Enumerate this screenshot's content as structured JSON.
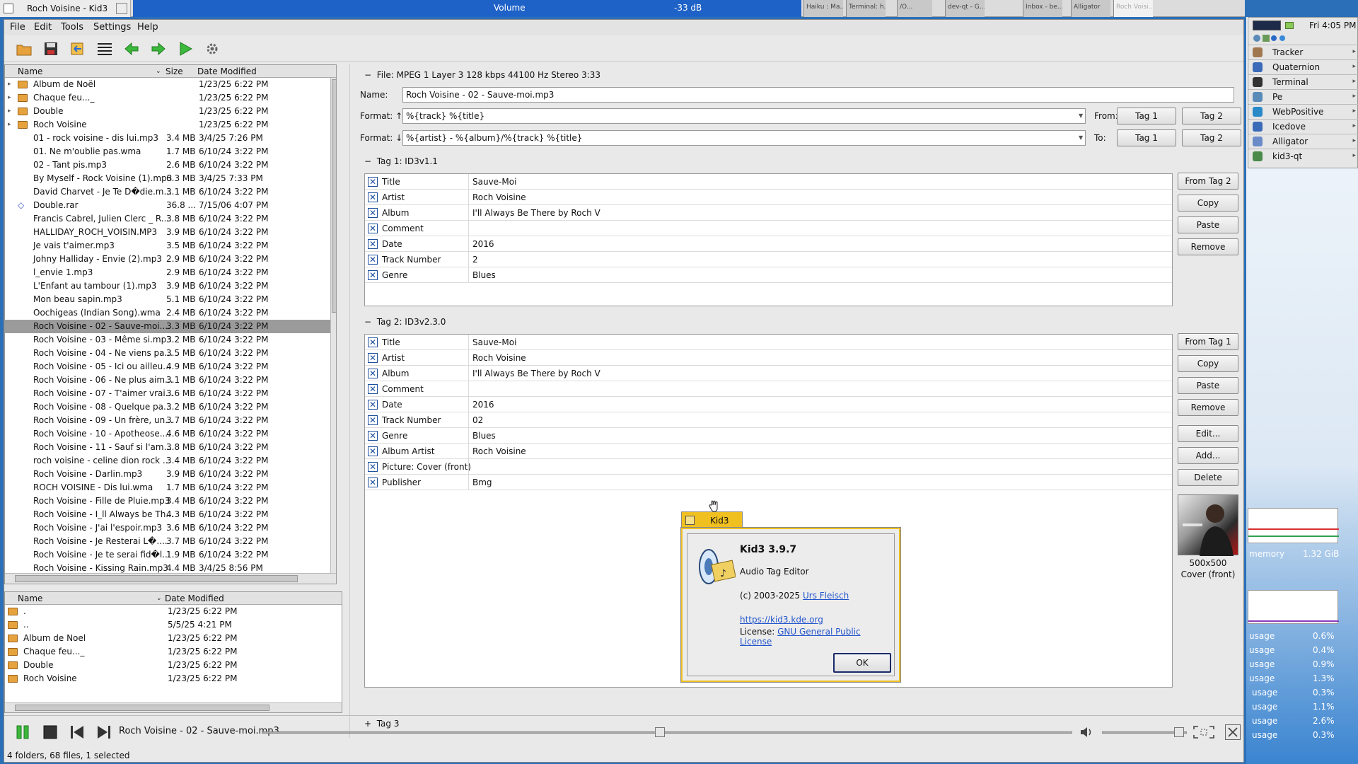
{
  "topbar": {
    "window_title": "Roch Voisine - Kid3",
    "volume_label": "Volume",
    "volume_db": "-33 dB",
    "mini_windows": [
      "Haiku : Ma...",
      "Terminal: h...",
      "/O...",
      "dev-qt - G...",
      "Inbox - be...",
      "Alligator",
      "Roch Voisi..."
    ]
  },
  "menubar": [
    "File",
    "Edit",
    "Tools",
    "Settings",
    "Help"
  ],
  "toolbar_icons": [
    "open-folder-icon",
    "save-icon",
    "revert-icon",
    "select-all-icon",
    "previous-file-icon",
    "next-file-icon",
    "play-icon",
    "settings-icon"
  ],
  "file_list": {
    "headers": {
      "name": "Name",
      "size": "Size",
      "modified": "Date Modified"
    },
    "rows": [
      {
        "name": "Album de Noël",
        "size": "",
        "date": "1/23/25 6:22 PM",
        "folder": true
      },
      {
        "name": "Chaque feu..._",
        "size": "",
        "date": "1/23/25 6:22 PM",
        "folder": true
      },
      {
        "name": "Double",
        "size": "",
        "date": "1/23/25 6:22 PM",
        "folder": true
      },
      {
        "name": "Roch Voisine",
        "size": "",
        "date": "1/23/25 6:22 PM",
        "folder": true
      },
      {
        "name": "01 - rock voisine - dis lui.mp3",
        "size": "3.4 MB",
        "date": "3/4/25 7:26 PM"
      },
      {
        "name": "01. Ne m'oublie pas.wma",
        "size": "1.7 MB",
        "date": "6/10/24 3:22 PM"
      },
      {
        "name": "02 - Tant pis.mp3",
        "size": "2.6 MB",
        "date": "6/10/24 3:22 PM"
      },
      {
        "name": "By Myself - Rock Voisine (1).mp3",
        "size": "6.3 MB",
        "date": "3/4/25 7:33 PM"
      },
      {
        "name": "David Charvet - Je Te D�die.m...",
        "size": "3.1 MB",
        "date": "6/10/24 3:22 PM"
      },
      {
        "name": "Double.rar",
        "size": "36.8 ...",
        "date": "7/15/06 4:07 PM"
      },
      {
        "name": "Francis Cabrel, Julien Clerc _ R...",
        "size": "3.8 MB",
        "date": "6/10/24 3:22 PM"
      },
      {
        "name": "HALLIDAY_ROCH_VOISIN.MP3",
        "size": "3.9 MB",
        "date": "6/10/24 3:22 PM"
      },
      {
        "name": "Je vais t'aimer.mp3",
        "size": "3.5 MB",
        "date": "6/10/24 3:22 PM"
      },
      {
        "name": "Johny Halliday - Envie (2).mp3",
        "size": "2.9 MB",
        "date": "6/10/24 3:22 PM"
      },
      {
        "name": "l_envie 1.mp3",
        "size": "2.9 MB",
        "date": "6/10/24 3:22 PM"
      },
      {
        "name": "L'Enfant au tambour (1).mp3",
        "size": "3.9 MB",
        "date": "6/10/24 3:22 PM"
      },
      {
        "name": "Mon beau sapin.mp3",
        "size": "5.1 MB",
        "date": "6/10/24 3:22 PM"
      },
      {
        "name": "Oochigeas (Indian Song).wma",
        "size": "2.4 MB",
        "date": "6/10/24 3:22 PM"
      },
      {
        "name": "Roch Voisine - 02 - Sauve-moi....",
        "size": "3.3 MB",
        "date": "6/10/24 3:22 PM",
        "selected": true
      },
      {
        "name": "Roch Voisine - 03 - Même si.mp3",
        "size": "3.2 MB",
        "date": "6/10/24 3:22 PM"
      },
      {
        "name": "Roch Voisine - 04 - Ne viens pa...",
        "size": "3.5 MB",
        "date": "6/10/24 3:22 PM"
      },
      {
        "name": "Roch Voisine - 05 - Ici ou ailleu...",
        "size": "4.9 MB",
        "date": "6/10/24 3:22 PM"
      },
      {
        "name": "Roch Voisine - 06 - Ne plus aim...",
        "size": "3.1 MB",
        "date": "6/10/24 3:22 PM"
      },
      {
        "name": "Roch Voisine - 07 - T'aimer vrai...",
        "size": "3.6 MB",
        "date": "6/10/24 3:22 PM"
      },
      {
        "name": "Roch Voisine - 08 - Quelque pa...",
        "size": "3.2 MB",
        "date": "6/10/24 3:22 PM"
      },
      {
        "name": "Roch Voisine - 09 - Un frère, un...",
        "size": "3.7 MB",
        "date": "6/10/24 3:22 PM"
      },
      {
        "name": "Roch Voisine - 10 - Apotheose....",
        "size": "4.6 MB",
        "date": "6/10/24 3:22 PM"
      },
      {
        "name": "Roch Voisine - 11 - Sauf si l'am...",
        "size": "3.8 MB",
        "date": "6/10/24 3:22 PM"
      },
      {
        "name": "roch voisine - celine dion rock ...",
        "size": "3.4 MB",
        "date": "6/10/24 3:22 PM"
      },
      {
        "name": "Roch Voisine - Darlin.mp3",
        "size": "3.9 MB",
        "date": "6/10/24 3:22 PM"
      },
      {
        "name": "ROCH VOISINE - Dis lui.wma",
        "size": "1.7 MB",
        "date": "6/10/24 3:22 PM"
      },
      {
        "name": "Roch Voisine - Fille de Pluie.mp3",
        "size": "3.4 MB",
        "date": "6/10/24 3:22 PM"
      },
      {
        "name": "Roch Voisine - I_ll Always be Th...",
        "size": "4.3 MB",
        "date": "6/10/24 3:22 PM"
      },
      {
        "name": "Roch Voisine - J'ai l'espoir.mp3",
        "size": "3.6 MB",
        "date": "6/10/24 3:22 PM"
      },
      {
        "name": "Roch Voisine - Je Resterai L�....",
        "size": "3.7 MB",
        "date": "6/10/24 3:22 PM"
      },
      {
        "name": "Roch Voisine - Je te serai fid�l...",
        "size": "1.9 MB",
        "date": "6/10/24 3:22 PM"
      },
      {
        "name": "Roch Voisine - Kissing Rain.mp3",
        "size": "4.4 MB",
        "date": "3/4/25 8:56 PM"
      }
    ]
  },
  "dir_list": {
    "headers": {
      "name": "Name",
      "modified": "Date Modified"
    },
    "rows": [
      {
        "name": ".",
        "date": "1/23/25 6:22 PM"
      },
      {
        "name": "..",
        "date": "5/5/25 4:21 PM"
      },
      {
        "name": "Album de Noel",
        "date": "1/23/25 6:22 PM"
      },
      {
        "name": "Chaque feu..._",
        "date": "1/23/25 6:22 PM"
      },
      {
        "name": "Double",
        "date": "1/23/25 6:22 PM"
      },
      {
        "name": "Roch Voisine",
        "date": "1/23/25 6:22 PM"
      }
    ]
  },
  "file_info": {
    "header": "File: MPEG 1 Layer 3 128 kbps 44100 Hz Stereo 3:33",
    "name_label": "Name:",
    "name_value": "Roch Voisine - 02 - Sauve-moi.mp3",
    "format_up_label": "Format: ↑",
    "format_up_value": "%{track} %{title}",
    "format_down_label": "Format: ↓",
    "format_down_value": "%{artist} - %{album}/%{track} %{title}",
    "from_label": "From:",
    "to_label": "To:",
    "tag1_btn": "Tag 1",
    "tag2_btn": "Tag 2"
  },
  "tag1": {
    "header": "Tag 1: ID3v1.1",
    "rows": [
      {
        "name": "Title",
        "value": "Sauve-Moi"
      },
      {
        "name": "Artist",
        "value": "Roch Voisine"
      },
      {
        "name": "Album",
        "value": "I'll Always Be There by Roch V"
      },
      {
        "name": "Comment",
        "value": ""
      },
      {
        "name": "Date",
        "value": "2016"
      },
      {
        "name": "Track Number",
        "value": "2"
      },
      {
        "name": "Genre",
        "value": "Blues"
      }
    ],
    "buttons": [
      "From Tag 2",
      "Copy",
      "Paste",
      "Remove"
    ]
  },
  "tag2": {
    "header": "Tag 2: ID3v2.3.0",
    "rows": [
      {
        "name": "Title",
        "value": "Sauve-Moi"
      },
      {
        "name": "Artist",
        "value": "Roch Voisine"
      },
      {
        "name": "Album",
        "value": "I'll Always Be There by Roch V"
      },
      {
        "name": "Comment",
        "value": ""
      },
      {
        "name": "Date",
        "value": "2016"
      },
      {
        "name": "Track Number",
        "value": "02"
      },
      {
        "name": "Genre",
        "value": "Blues"
      },
      {
        "name": "Album Artist",
        "value": "Roch Voisine"
      },
      {
        "name": "Picture: Cover (front)",
        "value": ""
      },
      {
        "name": "Publisher",
        "value": "Bmg"
      }
    ],
    "buttons": [
      "From Tag 1",
      "Copy",
      "Paste",
      "Remove",
      "Edit...",
      "Add...",
      "Delete"
    ],
    "cover_size": "500x500",
    "cover_label": "Cover (front)"
  },
  "tag3_header": "Tag 3",
  "about_dialog": {
    "tab_title": "Kid3",
    "app_name": "Kid3 3.9.7",
    "subtitle": "Audio Tag Editor",
    "copyright": "(c) 2003-2025 ",
    "author": "Urs Fleisch",
    "url": "https://kid3.kde.org",
    "license_label": "License: ",
    "license": "GNU General Public License",
    "ok": "OK"
  },
  "player": {
    "now_playing": "Roch Voisine - 02 - Sauve-moi.mp3",
    "position": 0.49,
    "volume": 0.9
  },
  "status_bar": "4 folders, 68 files, 1 selected",
  "deskbar": {
    "clock": "Fri 4:05 PM",
    "items": [
      "Tracker",
      "Quaternion",
      "Terminal",
      "Pe",
      "WebPositive",
      "Icedove",
      "Alligator",
      "kid3-qt"
    ],
    "memory_label": "memory",
    "memory_value": "1.32 GiB",
    "cpu_rows": [
      {
        "label": "usage",
        "value": "0.6%"
      },
      {
        "label": "usage",
        "value": "0.4%"
      },
      {
        "label": "usage",
        "value": "0.9%"
      },
      {
        "label": "usage",
        "value": "1.3%"
      },
      {
        "label": "usage",
        "value": "0.3%"
      },
      {
        "label": "usage",
        "value": "1.1%"
      },
      {
        "label": "usage",
        "value": "2.6%"
      },
      {
        "label": "usage",
        "value": "0.3%"
      }
    ]
  }
}
